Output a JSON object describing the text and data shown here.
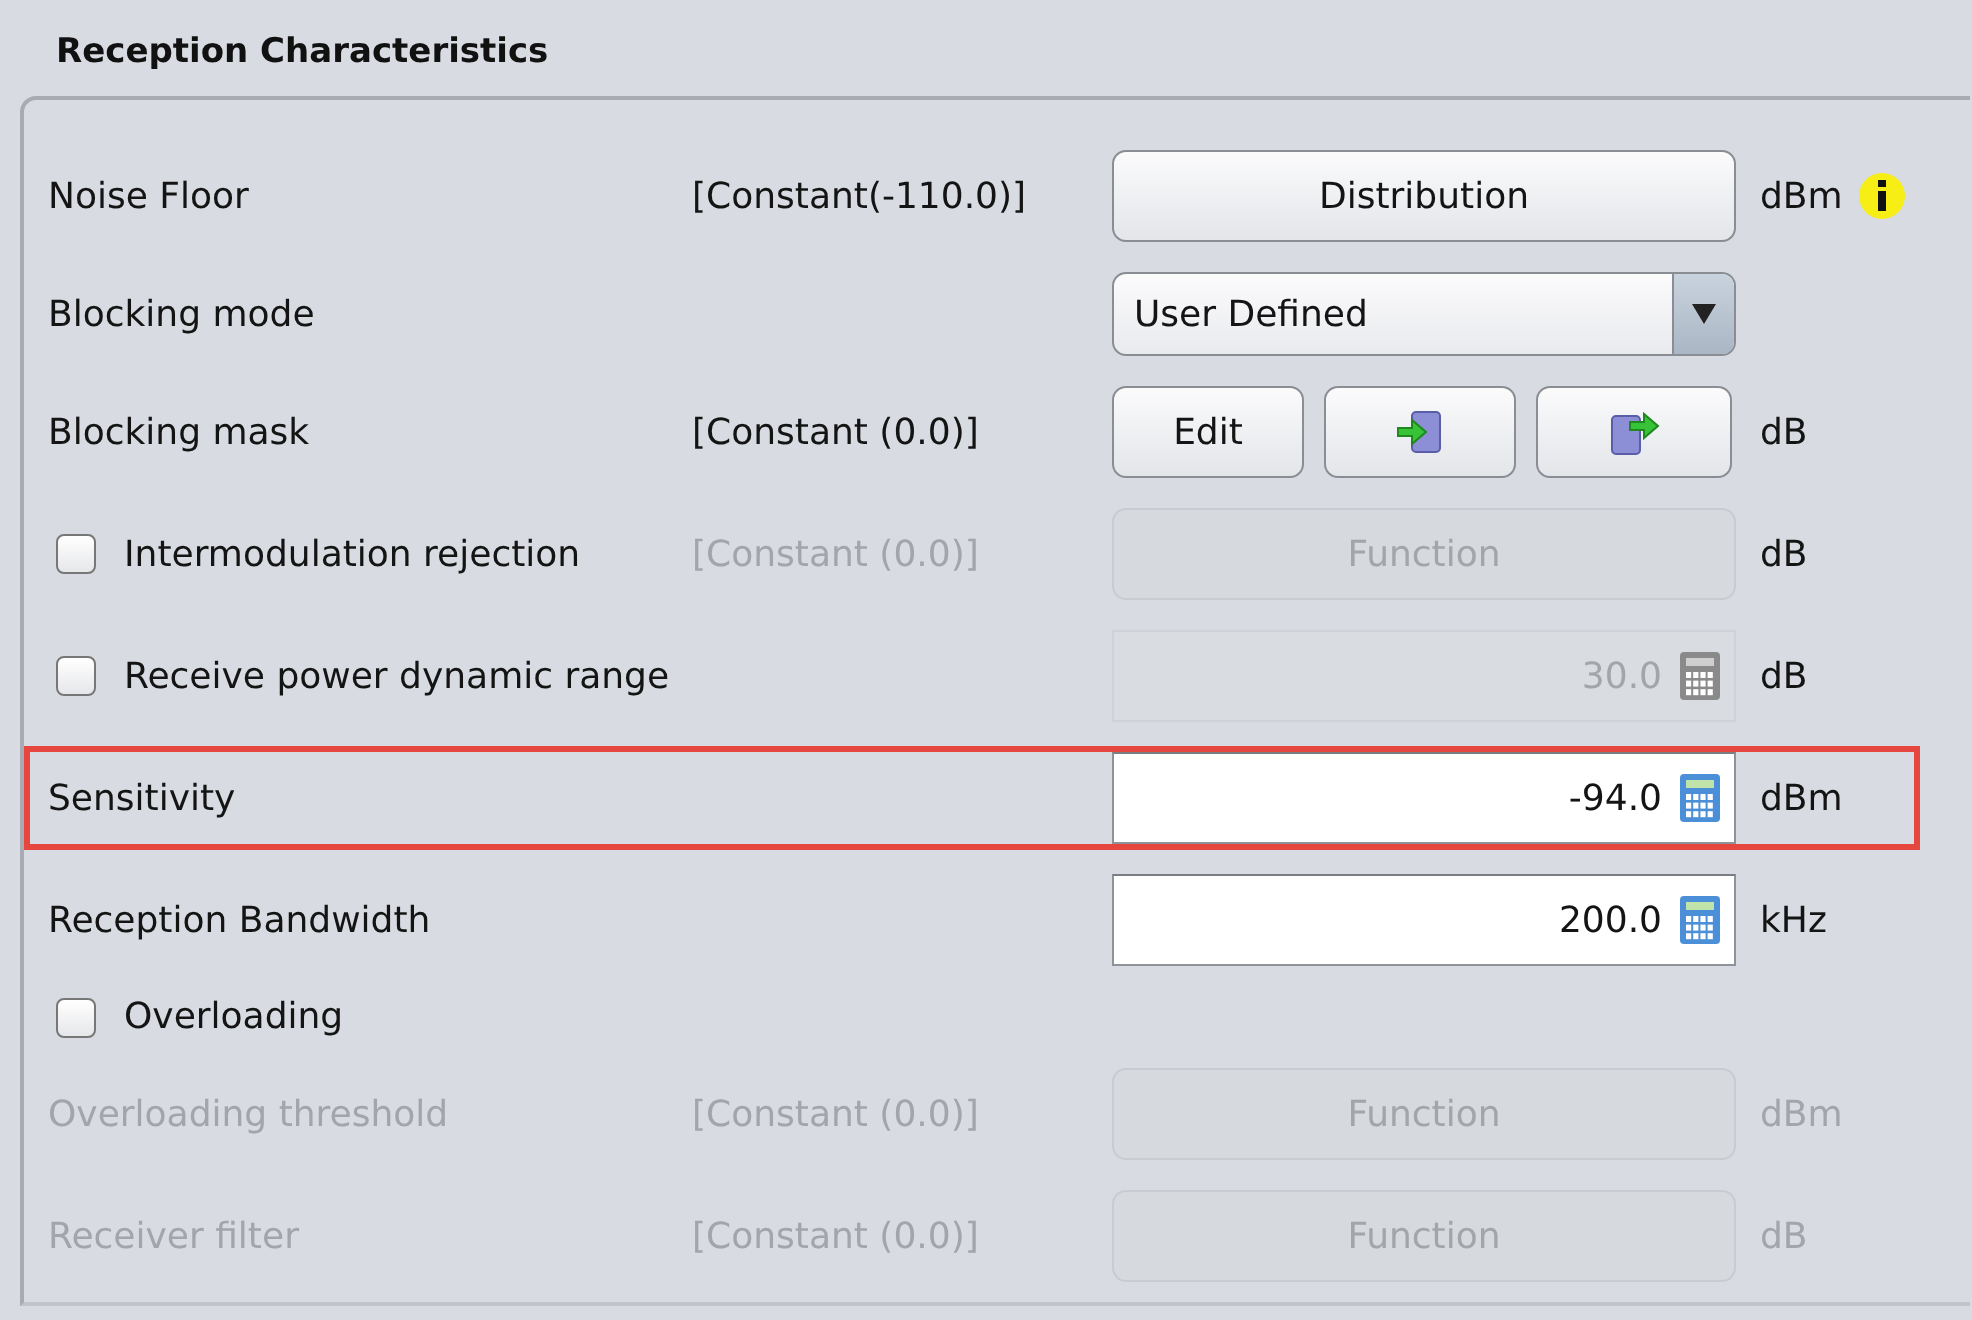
{
  "panel": {
    "title": "Reception Characteristics"
  },
  "rows": [
    {
      "label": "Noise Floor",
      "disabled": false,
      "highlighted": false,
      "value": "[Constant(-110.0)]",
      "control": {
        "kind": "button",
        "label": "Distribution"
      },
      "unit": "dBm",
      "info": true
    },
    {
      "label": "Blocking mode",
      "disabled": false,
      "highlighted": false,
      "control": {
        "kind": "dropdown",
        "value": "User Defined"
      }
    },
    {
      "label": "Blocking mask",
      "disabled": false,
      "highlighted": false,
      "value": "[Constant (0.0)]",
      "control": {
        "kind": "buttons",
        "label": "Edit"
      },
      "unit": "dB"
    },
    {
      "label": "Intermodulation rejection",
      "checkbox": {
        "checked": false
      },
      "disabled": false,
      "value_disabled": true,
      "highlighted": false,
      "value": "[Constant (0.0)]",
      "control": {
        "kind": "button",
        "label": "Function",
        "disabled": true
      },
      "unit": "dB"
    },
    {
      "label": "Receive power dynamic range",
      "checkbox": {
        "checked": false
      },
      "disabled": false,
      "highlighted": false,
      "control": {
        "kind": "number",
        "value": "30.0",
        "disabled": true
      },
      "unit": "dB"
    },
    {
      "label": "Sensitivity",
      "disabled": false,
      "highlighted": true,
      "control": {
        "kind": "number",
        "value": "-94.0",
        "disabled": false
      },
      "unit": "dBm"
    },
    {
      "label": "Reception Bandwidth",
      "disabled": false,
      "highlighted": false,
      "control": {
        "kind": "number",
        "value": "200.0",
        "disabled": false
      },
      "unit": "kHz"
    },
    {
      "label": "Overloading",
      "checkbox": {
        "checked": false
      },
      "disabled": false,
      "highlighted": false
    },
    {
      "label": "Overloading threshold",
      "disabled": true,
      "highlighted": false,
      "value": "[Constant (0.0)]",
      "control": {
        "kind": "button",
        "label": "Function",
        "disabled": true
      },
      "unit": "dBm"
    },
    {
      "label": "Receiver filter",
      "disabled": true,
      "highlighted": false,
      "value": "[Constant (0.0)]",
      "control": {
        "kind": "button",
        "label": "Function",
        "disabled": true
      },
      "unit": "dB"
    }
  ]
}
